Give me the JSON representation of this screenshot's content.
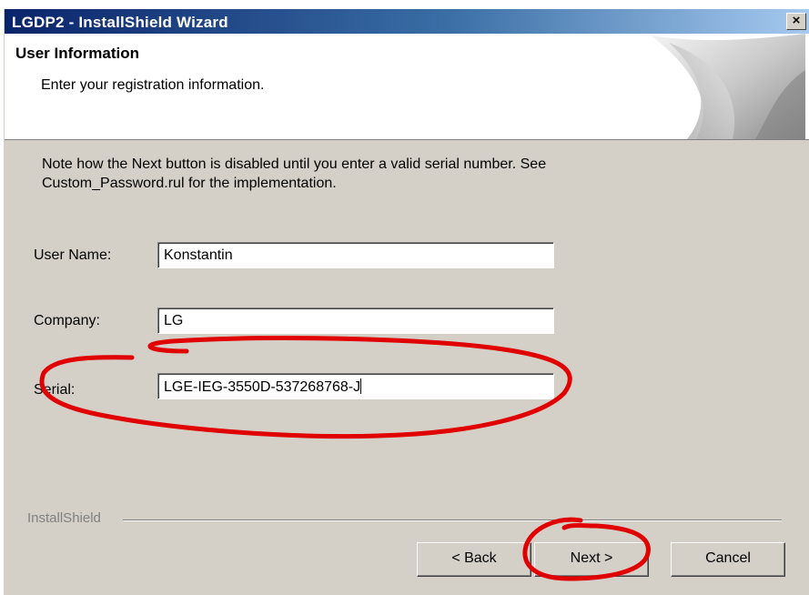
{
  "window": {
    "title": "LGDP2 - InstallShield Wizard",
    "close_glyph": "×"
  },
  "header": {
    "title": "User Information",
    "subtitle": "Enter your registration information."
  },
  "note": "Note how the Next button is disabled until you enter a valid serial number. See Custom_Password.rul for the implementation.",
  "fields": {
    "user_name": {
      "label": "User Name:",
      "value": "Konstantin"
    },
    "company": {
      "label": "Company:",
      "value": "LG"
    },
    "serial": {
      "label": "Serial:",
      "value": "LGE-IEG-3550D-537268768-J"
    }
  },
  "brand": "InstallShield",
  "buttons": {
    "back": "< Back",
    "next": "Next >",
    "cancel": "Cancel"
  },
  "annotation_color": "#e00000"
}
